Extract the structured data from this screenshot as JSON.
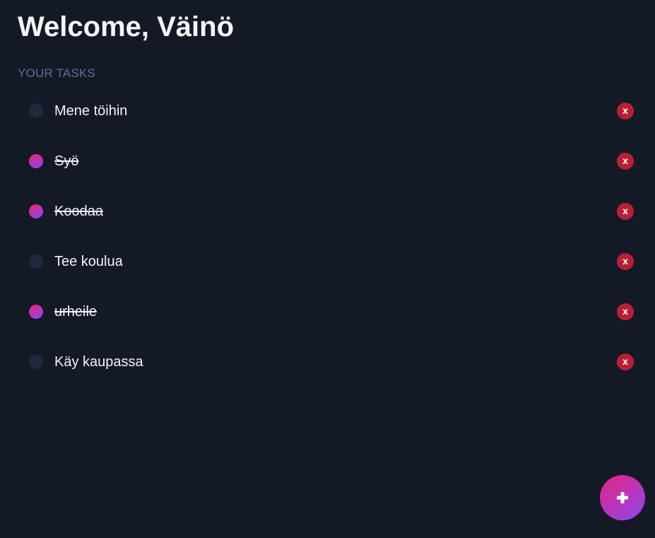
{
  "header": {
    "title": "Welcome, Väinö"
  },
  "tasks_section": {
    "label": "YOUR TASKS",
    "items": [
      {
        "label": "Mene töihin",
        "done": false,
        "delete_label": "x"
      },
      {
        "label": "Syö",
        "done": true,
        "delete_label": "x"
      },
      {
        "label": "Koodaa",
        "done": true,
        "delete_label": "x"
      },
      {
        "label": "Tee koulua",
        "done": false,
        "delete_label": "x"
      },
      {
        "label": "urheile",
        "done": true,
        "delete_label": "x"
      },
      {
        "label": "Käy kaupassa",
        "done": false,
        "delete_label": "x"
      }
    ]
  },
  "add_button": {
    "icon": "plus-icon"
  },
  "colors": {
    "background": "#131a26",
    "accent_start": "#e6247d",
    "accent_end": "#8f46f2",
    "delete": "#b81f36",
    "section_label": "#5d6f9b",
    "unchecked": "#1f2a3e"
  }
}
